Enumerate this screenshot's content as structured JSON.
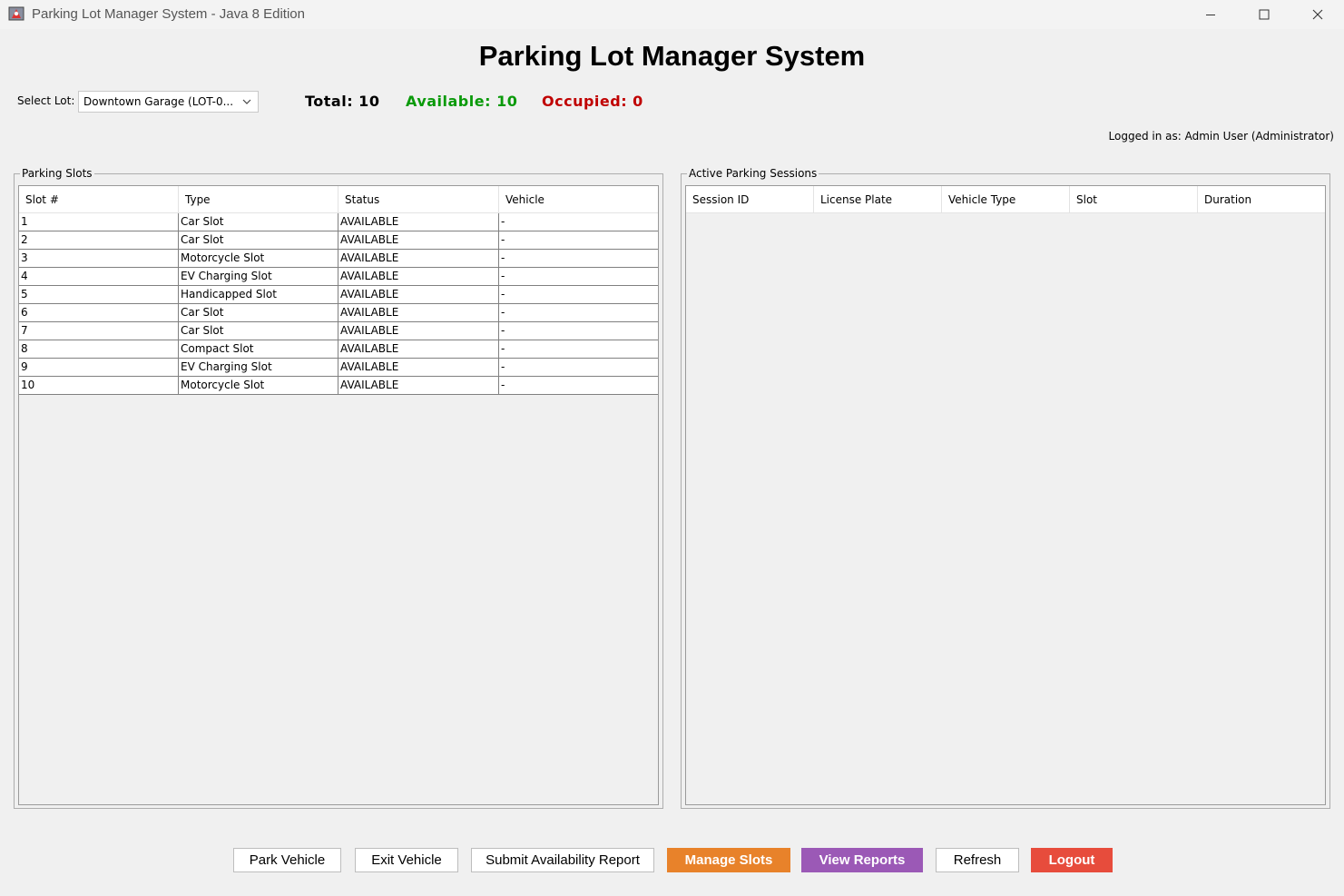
{
  "window": {
    "title": "Parking Lot Manager System - Java 8 Edition"
  },
  "header": {
    "title": "Parking Lot Manager System",
    "lot_label": "Select Lot:",
    "lot_selected": "Downtown Garage (LOT-0...",
    "stats": {
      "total": "Total: 10",
      "available": "Available: 10",
      "occupied": "Occupied: 0"
    },
    "logged_in": "Logged in as: Admin User (Administrator)"
  },
  "colors": {
    "available": "#0a9a0a",
    "occupied": "#c00000",
    "manage_slots": "#e8822a",
    "view_reports": "#9b59b6",
    "logout": "#e74c3c"
  },
  "slots_panel": {
    "title": "Parking Slots",
    "columns": [
      "Slot #",
      "Type",
      "Status",
      "Vehicle"
    ],
    "rows": [
      [
        "1",
        "Car Slot",
        "AVAILABLE",
        "-"
      ],
      [
        "2",
        "Car Slot",
        "AVAILABLE",
        "-"
      ],
      [
        "3",
        "Motorcycle Slot",
        "AVAILABLE",
        "-"
      ],
      [
        "4",
        "EV Charging Slot",
        "AVAILABLE",
        "-"
      ],
      [
        "5",
        "Handicapped Slot",
        "AVAILABLE",
        "-"
      ],
      [
        "6",
        "Car Slot",
        "AVAILABLE",
        "-"
      ],
      [
        "7",
        "Car Slot",
        "AVAILABLE",
        "-"
      ],
      [
        "8",
        "Compact Slot",
        "AVAILABLE",
        "-"
      ],
      [
        "9",
        "EV Charging Slot",
        "AVAILABLE",
        "-"
      ],
      [
        "10",
        "Motorcycle Slot",
        "AVAILABLE",
        "-"
      ]
    ]
  },
  "sessions_panel": {
    "title": "Active Parking Sessions",
    "columns": [
      "Session ID",
      "License Plate",
      "Vehicle Type",
      "Slot",
      "Duration"
    ],
    "rows": []
  },
  "buttons": {
    "park": "Park Vehicle",
    "exit": "Exit Vehicle",
    "report": "Submit Availability Report",
    "manage": "Manage Slots",
    "view_reports": "View Reports",
    "refresh": "Refresh",
    "logout": "Logout"
  }
}
